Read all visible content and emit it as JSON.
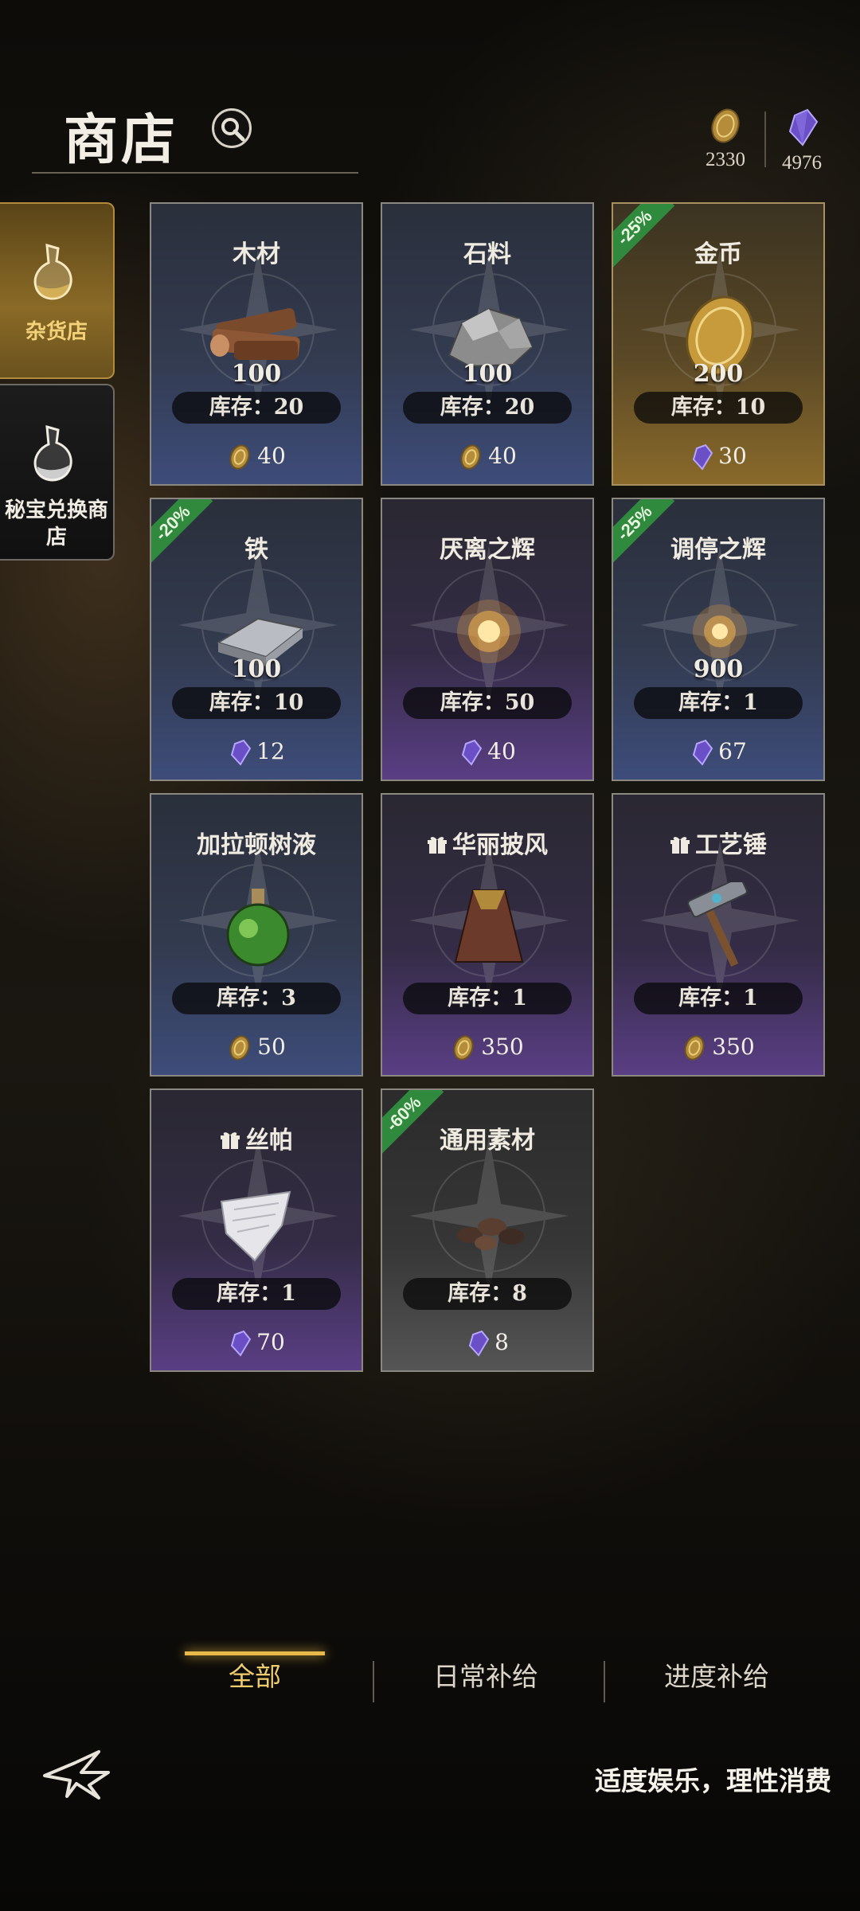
{
  "header": {
    "title": "商店"
  },
  "currencies": [
    {
      "icon": "gold-coin-icon",
      "value": "2330"
    },
    {
      "icon": "purple-crystal-icon",
      "value": "4976"
    }
  ],
  "side_tabs": [
    {
      "label": "杂货店",
      "icon": "potion-flask-icon",
      "active": true
    },
    {
      "label": "秘宝兑换商店",
      "icon": "potion-flask-icon",
      "active": false
    }
  ],
  "items": [
    {
      "name": "木材",
      "qty": "100",
      "stock": "库存：20",
      "price": "40",
      "currency": "gold",
      "discount": "",
      "gift": false,
      "theme": "blue",
      "icon": "wood-icon"
    },
    {
      "name": "石料",
      "qty": "100",
      "stock": "库存：20",
      "price": "40",
      "currency": "gold",
      "discount": "",
      "gift": false,
      "theme": "blue",
      "icon": "stone-icon"
    },
    {
      "name": "金币",
      "qty": "200",
      "stock": "库存：10",
      "price": "30",
      "currency": "crystal",
      "discount": "-25%",
      "gift": false,
      "theme": "gold",
      "icon": "gold-coin-icon"
    },
    {
      "name": "铁",
      "qty": "100",
      "stock": "库存：10",
      "price": "12",
      "currency": "crystal",
      "discount": "-20%",
      "gift": false,
      "theme": "blue",
      "icon": "iron-ingot-icon"
    },
    {
      "name": "厌离之辉",
      "qty": "",
      "stock": "库存：50",
      "price": "40",
      "currency": "crystal",
      "discount": "",
      "gift": false,
      "theme": "purple",
      "icon": "glow-orb-icon"
    },
    {
      "name": "调停之辉",
      "qty": "900",
      "stock": "库存：1",
      "price": "67",
      "currency": "crystal",
      "discount": "-25%",
      "gift": false,
      "theme": "blue",
      "icon": "glow-orb-icon"
    },
    {
      "name": "加拉顿树液",
      "qty": "",
      "stock": "库存：3",
      "price": "50",
      "currency": "gold",
      "discount": "",
      "gift": false,
      "theme": "blue",
      "icon": "green-potion-icon"
    },
    {
      "name": "华丽披风",
      "qty": "",
      "stock": "库存：1",
      "price": "350",
      "currency": "gold",
      "discount": "",
      "gift": true,
      "theme": "purple",
      "icon": "cloak-icon"
    },
    {
      "name": "工艺锤",
      "qty": "",
      "stock": "库存：1",
      "price": "350",
      "currency": "gold",
      "discount": "",
      "gift": true,
      "theme": "purple",
      "icon": "hammer-icon"
    },
    {
      "name": "丝帕",
      "qty": "",
      "stock": "库存：1",
      "price": "70",
      "currency": "crystal",
      "discount": "",
      "gift": true,
      "theme": "purple",
      "icon": "silk-handkerchief-icon"
    },
    {
      "name": "通用素材",
      "qty": "",
      "stock": "库存：8",
      "price": "8",
      "currency": "crystal",
      "discount": "-60%",
      "gift": false,
      "theme": "gray",
      "icon": "materials-pile-icon"
    }
  ],
  "bottom_tabs": [
    {
      "label": "全部",
      "active": true
    },
    {
      "label": "日常补给",
      "active": false
    },
    {
      "label": "进度补给",
      "active": false
    }
  ],
  "footer": {
    "note": "适度娱乐，理性消费"
  }
}
